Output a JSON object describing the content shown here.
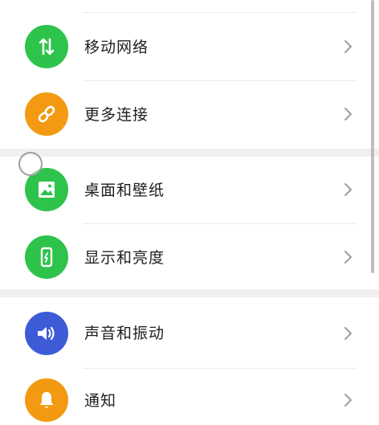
{
  "settings": {
    "items": [
      {
        "label": "",
        "icon": "top-partial-icon",
        "color": "#26b3e8"
      },
      {
        "label": "移动网络",
        "icon": "mobile-data-arrows-icon",
        "color": "#2ec34a"
      },
      {
        "label": "更多连接",
        "icon": "link-chain-icon",
        "color": "#f39a12"
      },
      {
        "label": "桌面和壁纸",
        "icon": "wallpaper-image-icon",
        "color": "#2ec34a"
      },
      {
        "label": "显示和亮度",
        "icon": "display-brightness-icon",
        "color": "#2ec34a"
      },
      {
        "label": "声音和振动",
        "icon": "speaker-volume-icon",
        "color": "#3d5bd6"
      },
      {
        "label": "通知",
        "icon": "bell-icon",
        "color": "#f39a12"
      }
    ]
  },
  "colors": {
    "background": "#f0f0f0",
    "card": "#ffffff",
    "text": "#1f1f1f",
    "chevron": "#9e9e9e"
  }
}
